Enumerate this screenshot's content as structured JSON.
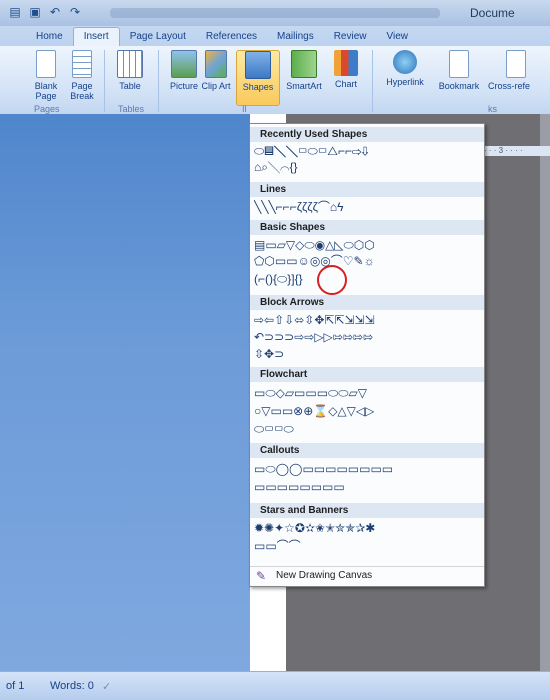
{
  "window": {
    "title": "Docume"
  },
  "quick_access": [
    {
      "icon": "word-logo-icon",
      "glyph": "▤"
    },
    {
      "icon": "save-icon",
      "glyph": "▣"
    },
    {
      "icon": "undo-icon",
      "glyph": "↶"
    },
    {
      "icon": "redo-icon",
      "glyph": "↷"
    }
  ],
  "tabs": [
    "Home",
    "Insert",
    "Page Layout",
    "References",
    "Mailings",
    "Review",
    "View"
  ],
  "ribbon": {
    "buttons": {
      "blank_page": "Blank Page",
      "page_break": "Page Break",
      "table": "Table",
      "picture": "Picture",
      "clip_art": "Clip Art",
      "shapes": "Shapes",
      "smartart": "SmartArt",
      "chart": "Chart",
      "hyperlink": "Hyperlink",
      "bookmark": "Bookmark",
      "cross_ref": "Cross-refe"
    },
    "groups": {
      "pages": "Pages",
      "tables": "Tables",
      "illus": "Il",
      "links": "ks"
    }
  },
  "ruler": {
    "text": "· · · 3 · · · ·"
  },
  "shapes_menu": {
    "sections": {
      "recent": "Recently Used Shapes",
      "lines": "Lines",
      "basic": "Basic Shapes",
      "block_arrows": "Block Arrows",
      "flowchart": "Flowchart",
      "callouts": "Callouts",
      "stars": "Stars and Banners"
    },
    "rows": {
      "recent1": "⬭▤╲╲▭⬭▭△⌐⌐⇨⇩",
      "recent2": "⌂⌕╲⌒{}",
      "lines1": "╲╲╲⌐⌐⌐ζζζζ⌒⌂ϟ",
      "basic1": "▤▭▱▽◇⬭◉△◺⬭⬡⬡",
      "basic2": "⬠⬡▭▭☺◎◎⌒♡✎☼",
      "basic3": "(⌐(){⬭}]{}",
      "arrows1": "⇨⇦⇧⇩⬄⇳✥⇱⇱⇲⇲⇲",
      "arrows2": "↶⊃⊃⊃⇨⇨▷▷⇰⇰⇰⇰",
      "arrows3": "⇳✥⊃",
      "flow1": "▭⬭◇▱▭▭▭⬭⬭▱▽",
      "flow2": "○▽▭▭⊗⊕⌛◇△▽◁▷",
      "flow3": "⬭▭▭⬭",
      "callout1": "▭⬭◯◯▭▭▭▭▭▭▭▭",
      "callout2": "▭▭▭▭▭▭▭▭",
      "stars1": "✹✺✦☆✪✫✬✭✮✯✰✱",
      "stars2": "▭▭⌒⌒"
    },
    "new_canvas": "New Drawing Canvas"
  },
  "status": {
    "page": "of 1",
    "words": "Words: 0",
    "check_icon": "proofing-check-icon"
  }
}
